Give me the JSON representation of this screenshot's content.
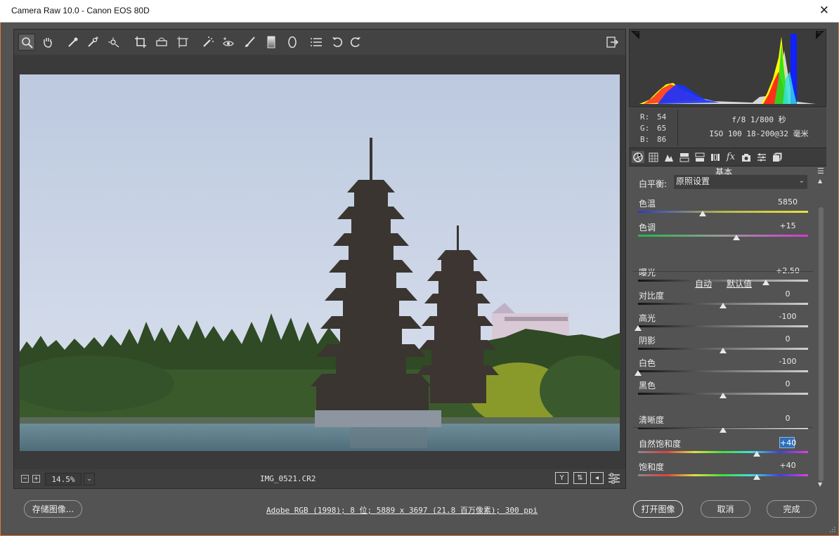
{
  "window": {
    "title": "Camera Raw 10.0 -  Canon EOS 80D",
    "close": "✕"
  },
  "toolbar": {
    "tools": [
      "zoom-tool",
      "hand-tool",
      "white-balance-tool",
      "color-sampler-tool",
      "targeted-adjustment-tool",
      "crop-tool",
      "straighten-tool",
      "transform-tool",
      "spot-removal-tool",
      "red-eye-removal-tool",
      "adjustment-brush-tool",
      "graduated-filter-tool",
      "radial-filter-tool",
      "preferences",
      "rotate-ccw",
      "rotate-cw"
    ]
  },
  "status": {
    "zoom": "14.5%",
    "filename": "IMG_0521.CR2"
  },
  "histogram": {},
  "readout": {
    "r_label": "R:",
    "r": "54",
    "g_label": "G:",
    "g": "65",
    "b_label": "B:",
    "b": "86",
    "aperture_shutter": "f/8  1/800 秒",
    "iso_lens": "ISO 100  18-200@32 毫米"
  },
  "panel": {
    "title": "基本",
    "wb_label": "白平衡:",
    "wb_value": "原照设置",
    "auto": "自动",
    "default": "默认值"
  },
  "sliders": [
    {
      "name": "temp",
      "label": "色温",
      "value": "5850",
      "pos": 0.38
    },
    {
      "name": "tint",
      "label": "色调",
      "value": "+15",
      "pos": 0.58
    },
    {
      "name": "exposure",
      "label": "曝光",
      "value": "+2.50",
      "pos": 0.75
    },
    {
      "name": "contrast",
      "label": "对比度",
      "value": "0",
      "pos": 0.5
    },
    {
      "name": "highlights",
      "label": "高光",
      "value": "-100",
      "pos": 0.0
    },
    {
      "name": "shadows",
      "label": "阴影",
      "value": "0",
      "pos": 0.5
    },
    {
      "name": "whites",
      "label": "白色",
      "value": "-100",
      "pos": 0.0
    },
    {
      "name": "blacks",
      "label": "黑色",
      "value": "0",
      "pos": 0.5
    },
    {
      "name": "clarity",
      "label": "清晰度",
      "value": "0",
      "pos": 0.5
    },
    {
      "name": "vibrance",
      "label": "自然饱和度",
      "value": "+40",
      "pos": 0.7
    },
    {
      "name": "saturation",
      "label": "饱和度",
      "value": "+40",
      "pos": 0.7
    }
  ],
  "footer": {
    "save": "存储图像...",
    "workflow": "Adobe RGB (1998); 8 位; 5889 x 3697 (21.8 百万像素); 300 ppi",
    "open": "打开图像",
    "cancel": "取消",
    "done": "完成"
  }
}
